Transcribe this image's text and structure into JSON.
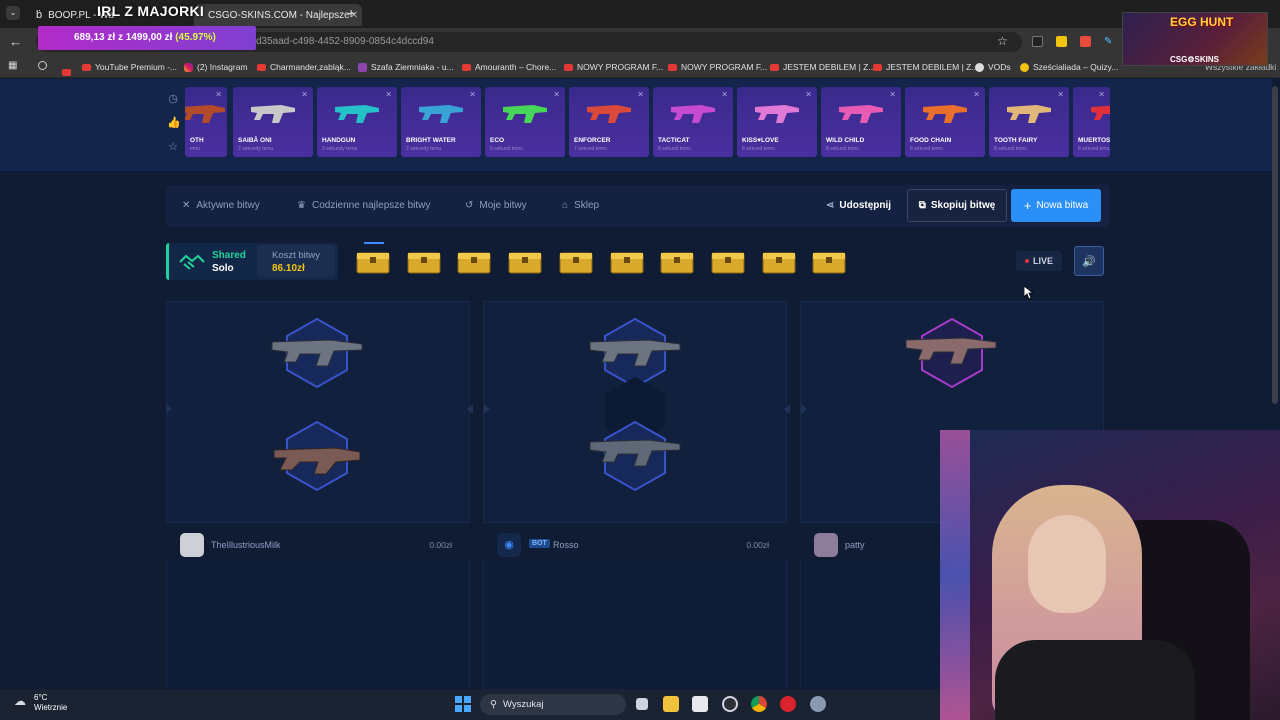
{
  "browser": {
    "tabs": [
      {
        "label": "BOOP.PL - Wa"
      },
      {
        "label": "CSGO-SKINS.COM - Najlepsze"
      }
    ],
    "url_fragment": "d35aad-c498-4452-8909-0854c4dccd94",
    "bookmarks": [
      "YouTube Premium -...",
      "(2) Instagram",
      "Charmander,zabląk...",
      "Szafa Ziemniaka - u...",
      "Amouranth – Chore...",
      "NOWY PROGRAM F...",
      "NOWY PROGRAM F...",
      "JESTEM DEBILEM | Z...",
      "JESTEM DEBILEM | Z...",
      "VODs",
      "Sześcialiada – Quizy...",
      "Wszystkie zakładki"
    ]
  },
  "overlays": {
    "stream_title": "IRL Z MAJORKI",
    "goal_amount": "689,13 zł",
    "goal_of": "z",
    "goal_target": "1499,00 zł",
    "goal_percent": "(45.97%)",
    "egg_title": "EGG HUNT",
    "egg_brand": "CSG⚙SKINS"
  },
  "recent_drops": [
    {
      "name": "OTH",
      "time": "emu",
      "color": "#b34a2a"
    },
    {
      "name": "SAIBĀ ONI",
      "time": "2 sekundy temu",
      "color": "#c8c8c8"
    },
    {
      "name": "HANDGUN",
      "time": "2 sekundy temu",
      "color": "#25c1c8"
    },
    {
      "name": "BRIGHT WATER",
      "time": "2 sekundy temu",
      "color": "#3aa3d6"
    },
    {
      "name": "ECO",
      "time": "5 sekund temu",
      "color": "#48d65a"
    },
    {
      "name": "ENFORCER",
      "time": "7 sekund temu",
      "color": "#d94a3a"
    },
    {
      "name": "TACTICAT",
      "time": "8 sekund temu",
      "color": "#c64bd0"
    },
    {
      "name": "KISS♥LOVE",
      "time": "8 sekund temu",
      "color": "#e07ad6"
    },
    {
      "name": "WILD CHILD",
      "time": "8 sekund temu",
      "color": "#e85bb5"
    },
    {
      "name": "FOOD CHAIN",
      "time": "8 sekund temu",
      "color": "#ea6e2c"
    },
    {
      "name": "TOOTH FAIRY",
      "time": "8 sekund temu",
      "color": "#e2b87a"
    },
    {
      "name": "MUERTOS",
      "time": "8 sekund temu",
      "color": "#e22f3a"
    }
  ],
  "nav": {
    "active_battles": "Aktywne bitwy",
    "daily_best": "Codzienne najlepsze bitwy",
    "my_battles": "Moje bitwy",
    "shop": "Sklep",
    "share": "Udostępnij",
    "copy_battle": "Skopiuj bitwę",
    "new_battle": "Nowa bitwa"
  },
  "battle": {
    "mode_label": "Shared",
    "mode_value": "Solo",
    "cost_label": "Koszt bitwy",
    "cost_value": "86.10zł",
    "case_count": 10,
    "live_label": "LIVE"
  },
  "players": [
    {
      "name": "TheIllustriousMilk",
      "value": "0.00zł",
      "bot": ""
    },
    {
      "name": "Rosso",
      "value": "0.00zł",
      "bot": "BOT"
    },
    {
      "name": "patty",
      "value": "",
      "bot": ""
    }
  ],
  "taskbar": {
    "temp": "6°C",
    "weather": "Wietrznie",
    "search_placeholder": "Wyszukaj"
  },
  "colors": {
    "accent": "#2a8ff7",
    "mode_accent": "#21d29a",
    "page_bg": "#0f1c33",
    "drop_bg": "#3a2a8c"
  }
}
